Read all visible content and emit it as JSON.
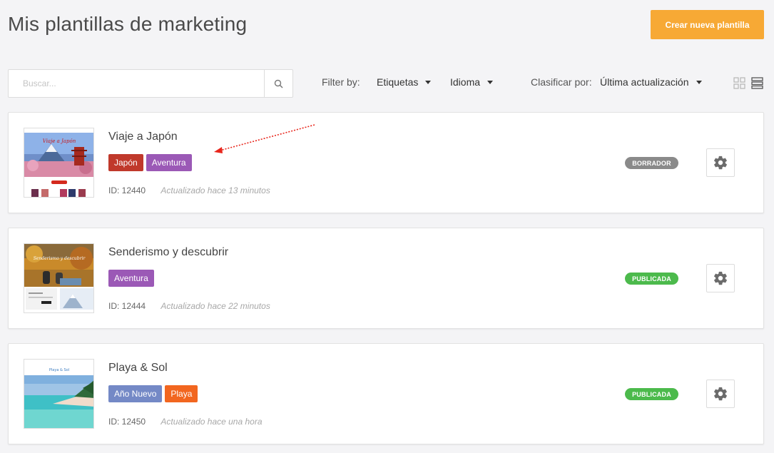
{
  "header": {
    "title": "Mis plantillas de marketing",
    "create_button": "Crear nueva plantilla"
  },
  "search": {
    "placeholder": "Buscar...",
    "value": "",
    "icon": "search-icon"
  },
  "filters": {
    "label": "Filter by:",
    "tags_dropdown": "Etiquetas",
    "language_dropdown": "Idioma",
    "sort_label": "Clasificar por:",
    "sort_value": "Última actualización"
  },
  "view": {
    "options": [
      "grid-view-icon",
      "list-view-icon"
    ],
    "selected": "list"
  },
  "templates": [
    {
      "title": "Viaje a Japón",
      "tags": [
        {
          "label": "Japón",
          "color": "#c0392b"
        },
        {
          "label": "Aventura",
          "color": "#9b59b6"
        }
      ],
      "id": "ID: 12440",
      "updated": "Actualizado hace 13 minutos",
      "status": "BORRADOR",
      "status_color": "#8a8a8a",
      "thumb_title": "Viaje a Japón"
    },
    {
      "title": "Senderismo y descubrir",
      "tags": [
        {
          "label": "Aventura",
          "color": "#9b59b6"
        }
      ],
      "id": "ID: 12444",
      "updated": "Actualizado hace 22 minutos",
      "status": "PUBLICADA",
      "status_color": "#4cba4c",
      "thumb_title": "Senderismo y descubrir"
    },
    {
      "title": "Playa & Sol",
      "tags": [
        {
          "label": "Año Nuevo",
          "color": "#7489c6"
        },
        {
          "label": "Playa",
          "color": "#f2661f"
        }
      ],
      "id": "ID: 12450",
      "updated": "Actualizado hace una hora",
      "status": "PUBLICADA",
      "status_color": "#4cba4c",
      "thumb_title": "Playa & Sol"
    }
  ],
  "colors": {
    "accent": "#f7a935",
    "annotation_arrow": "#e8261c"
  }
}
